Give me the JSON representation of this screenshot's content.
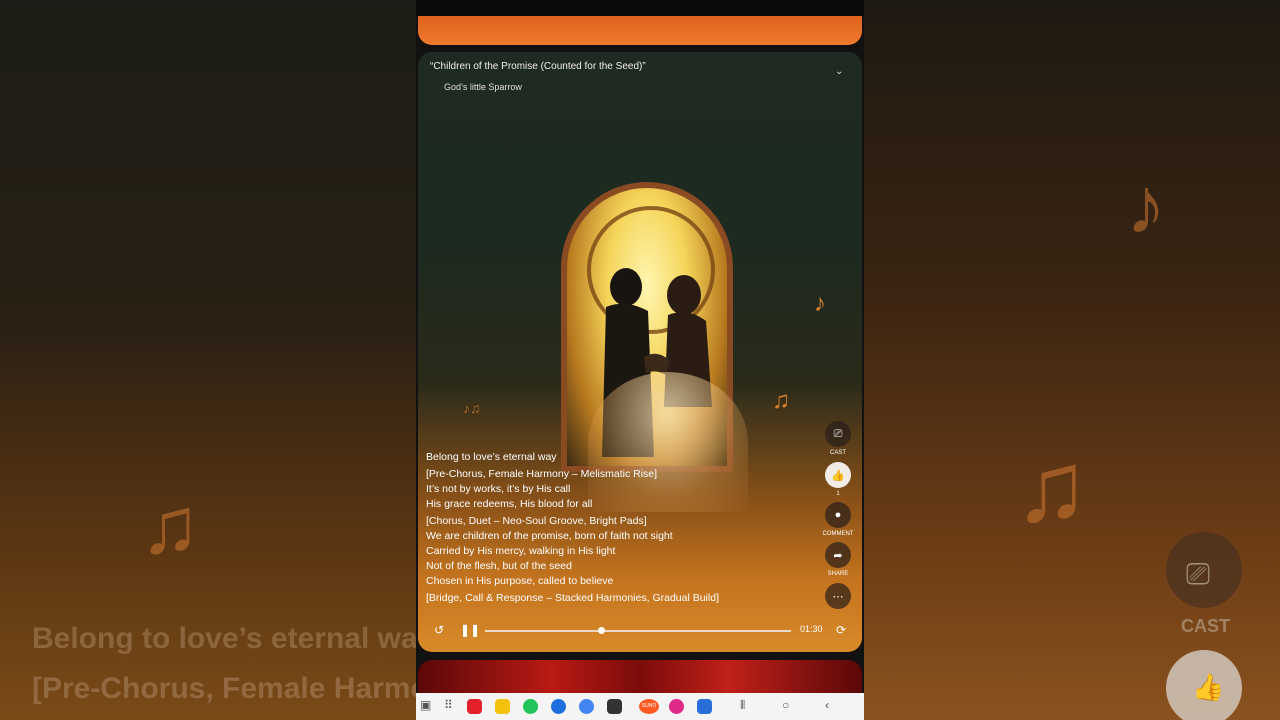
{
  "player": {
    "title": "“Children of the Promise (Counted for the Seed)”",
    "artist": "God’s little Sparrow",
    "time": "01:30",
    "progress": 0.38
  },
  "lyrics": [
    {
      "text": "Belong to love’s eternal way",
      "section": false
    },
    {
      "text": "[Pre-Chorus, Female Harmony – Melismatic Rise]",
      "section": true
    },
    {
      "text": "It’s not by works, it’s by His call",
      "section": false
    },
    {
      "text": "His grace redeems, His blood for all",
      "section": false
    },
    {
      "text": "[Chorus, Duet – Neo-Soul Groove, Bright Pads]",
      "section": true
    },
    {
      "text": "We are children of the promise, born of faith not sight",
      "section": false
    },
    {
      "text": "Carried by His mercy, walking in His light",
      "section": false
    },
    {
      "text": "Not of the flesh, but of the seed",
      "section": false
    },
    {
      "text": "Chosen in His purpose, called to believe",
      "section": false
    },
    {
      "text": "[Bridge, Call & Response – Stacked Harmonies, Gradual Build]",
      "section": true
    }
  ],
  "actions": {
    "cast_label": "CAST",
    "like_count": "1",
    "comment_label": "COMMENT",
    "share_label": "SHARE"
  },
  "background": {
    "line1": "Belong to love’s eternal way",
    "line2": "[Pre-Chorus, Female Harmo",
    "cast_label": "CAST"
  },
  "taskbar": {
    "app_colors": [
      "#e4202a",
      "#f4c20d",
      "#20c45a",
      "#1d6fe0",
      "#4285f4",
      "#333333",
      "#ff5a1f",
      "#e02a8a",
      "#2a6fd9"
    ],
    "suno_label": "SUNO"
  }
}
